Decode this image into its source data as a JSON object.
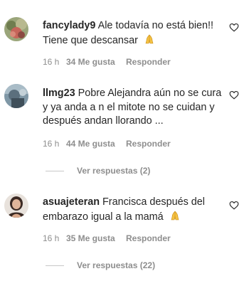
{
  "comments": [
    {
      "username": "fancylady9",
      "text": "Ale todavía no está bien!! Tiene que descansar",
      "emoji": "praying-hands-icon",
      "time": "16 h",
      "likes": "34 Me gusta",
      "reply": "Responder"
    },
    {
      "username": "llmg23",
      "text": "Pobre Alejandra aún no se cura y ya anda a n el mitote no se cuidan y después andan llorando ...",
      "time": "16 h",
      "likes": "44 Me gusta",
      "reply": "Responder",
      "replies": "Ver respuestas (2)"
    },
    {
      "username": "asuajeteran",
      "text": "Francisca después del embarazo igual a la mamá",
      "emoji": "praying-hands-icon",
      "time": "16 h",
      "likes": "35 Me gusta",
      "reply": "Responder",
      "replies": "Ver respuestas (22)"
    }
  ]
}
